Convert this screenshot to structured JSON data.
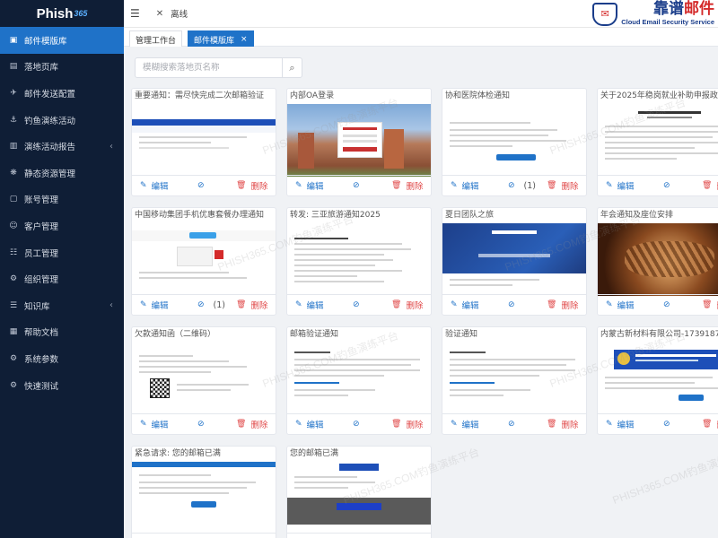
{
  "sidebar": {
    "logo_text": "Phish",
    "logo_sup": "365",
    "items": [
      {
        "label": "邮件模版库",
        "icon": "mail-template-icon",
        "glyph": "▣",
        "active": true,
        "chevron": ""
      },
      {
        "label": "落地页库",
        "icon": "landing-page-icon",
        "glyph": "▤",
        "active": false,
        "chevron": ""
      },
      {
        "label": "邮件发送配置",
        "icon": "send-config-icon",
        "glyph": "✈",
        "active": false,
        "chevron": ""
      },
      {
        "label": "钓鱼演练活动",
        "icon": "hook-icon",
        "glyph": "⚓",
        "active": false,
        "chevron": ""
      },
      {
        "label": "演练活动报告",
        "icon": "report-icon",
        "glyph": "▥",
        "active": false,
        "chevron": "‹"
      },
      {
        "label": "静态资源管理",
        "icon": "resource-icon",
        "glyph": "❋",
        "active": false,
        "chevron": ""
      },
      {
        "label": "账号管理",
        "icon": "account-icon",
        "glyph": "▢",
        "active": false,
        "chevron": ""
      },
      {
        "label": "客户管理",
        "icon": "customer-icon",
        "glyph": "☺",
        "active": false,
        "chevron": ""
      },
      {
        "label": "员工管理",
        "icon": "employee-icon",
        "glyph": "☷",
        "active": false,
        "chevron": ""
      },
      {
        "label": "组织管理",
        "icon": "organization-icon",
        "glyph": "⚙",
        "active": false,
        "chevron": ""
      },
      {
        "label": "知识库",
        "icon": "knowledge-icon",
        "glyph": "☰",
        "active": false,
        "chevron": "‹"
      },
      {
        "label": "帮助文档",
        "icon": "help-doc-icon",
        "glyph": "▦",
        "active": false,
        "chevron": ""
      },
      {
        "label": "系统参数",
        "icon": "system-params-icon",
        "glyph": "⚙",
        "active": false,
        "chevron": ""
      },
      {
        "label": "快速测试",
        "icon": "quick-test-icon",
        "glyph": "⚙",
        "active": false,
        "chevron": ""
      }
    ]
  },
  "header": {
    "status": "离线",
    "brand_main_1": "靠谱",
    "brand_main_2": "邮件",
    "brand_sub": "Cloud Email Security Service"
  },
  "tabs": [
    {
      "label": "管理工作台",
      "active": false
    },
    {
      "label": "邮件模版库",
      "active": true
    }
  ],
  "search": {
    "placeholder": "模糊搜索落地页名称",
    "value": ""
  },
  "actions": {
    "edit": "编辑",
    "delete": "删除"
  },
  "watermark": "PHISH365.COM钓鱼演练平台",
  "cards": [
    {
      "title": "重要通知：需尽快完成二次邮箱验证",
      "attachments": "",
      "thumb": "login-blue"
    },
    {
      "title": "内部OA登录",
      "attachments": "",
      "thumb": "oa-campus"
    },
    {
      "title": "协和医院体检通知",
      "attachments": "(1)",
      "thumb": "hospital"
    },
    {
      "title": "关于2025年稳岗就业补助申报政策发放",
      "attachments": "",
      "thumb": "policy"
    },
    {
      "title": "中国移动集团手机优惠套餐办理通知",
      "attachments": "(1)",
      "thumb": "mobile"
    },
    {
      "title": "转发: 三亚旅游通知2025",
      "attachments": "",
      "thumb": "travel"
    },
    {
      "title": "夏日团队之旅",
      "attachments": "",
      "thumb": "summer"
    },
    {
      "title": "年会通知及座位安排",
      "attachments": "",
      "thumb": "annual"
    },
    {
      "title": "欠款通知函（二维码）",
      "attachments": "",
      "thumb": "qr"
    },
    {
      "title": "邮箱验证通知",
      "attachments": "",
      "thumb": "verify-mail"
    },
    {
      "title": "验证通知",
      "attachments": "",
      "thumb": "verify"
    },
    {
      "title": "内蒙古新材料有限公司-17391871​5",
      "attachments": "",
      "thumb": "court"
    },
    {
      "title": "紧急请求: 您的邮箱已满",
      "attachments": "",
      "thumb": "full-1"
    },
    {
      "title": "您的邮箱已满",
      "attachments": "",
      "thumb": "full-2"
    }
  ]
}
